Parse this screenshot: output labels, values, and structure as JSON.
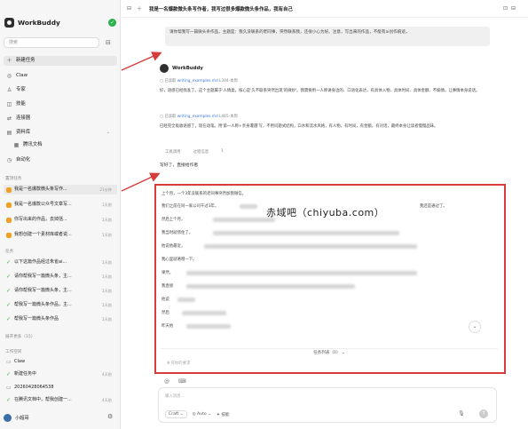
{
  "app": {
    "name": "WorkBuddy"
  },
  "sidebar": {
    "search_placeholder": "搜索",
    "nav": [
      {
        "label": "新建任务",
        "icon": "plus-icon"
      },
      {
        "label": "Claw",
        "icon": "claw-icon"
      },
      {
        "label": "专家",
        "icon": "expert-icon"
      },
      {
        "label": "技能",
        "icon": "skill-icon"
      },
      {
        "label": "连接器",
        "icon": "connector-icon"
      },
      {
        "label": "资料库",
        "icon": "library-icon"
      },
      {
        "label": "腾讯文档",
        "icon": "doc-icon"
      },
      {
        "label": "自动化",
        "icon": "auto-icon"
      }
    ],
    "pinned_label": "置顶任务",
    "pinned": [
      {
        "title": "我是一名爆款微头条写作...",
        "time": "21分钟"
      },
      {
        "title": "我是一名爆款公众号文章写...",
        "time": "1天前"
      },
      {
        "title": "你写出来的作品，去掉括...",
        "time": "1天前"
      },
      {
        "title": "我想创建一个素材库或者说...",
        "time": "1天前"
      }
    ],
    "tasks_label": "任务",
    "tasks": [
      {
        "title": "以下这篇作品经过朱雀ai...",
        "time": "1天前"
      },
      {
        "title": "请你帮我写一篇微头条，主...",
        "time": "1天前"
      },
      {
        "title": "请你帮我写一篇微头条，主...",
        "time": "1天前"
      },
      {
        "title": "帮我写一篇微头条作品，主...",
        "time": "1天前"
      },
      {
        "title": "帮我写一篇微头条作品",
        "time": "1天前"
      }
    ],
    "more_label": "展开更多（15）",
    "workspace_label": "工作空间",
    "workspace": [
      {
        "title": "Claw",
        "time": ""
      },
      {
        "title": "新建任务中",
        "time": "4天前"
      },
      {
        "title": "20260428064538",
        "time": ""
      },
      {
        "title": "在腾讯文档中，帮我创建一...",
        "time": "4天前"
      }
    ],
    "user": "小超哥"
  },
  "topbar": {
    "title": "我是一名爆款微头条写作者，我写过很多爆款微头条作品，我有自己"
  },
  "chat": {
    "prompt": "请你帮我写一篇微头条作品，主题是：我久没联系的老同事，突然联系我，还很小心为好。注意，写出来的作品，不能有ai创作痕迹。",
    "bot_name": "WorkBuddy",
    "ref1": "已读取",
    "ref1_file": "writing_examples.md",
    "ref1_meta": "L394-本周",
    "para1": "好，语感已经找准了。这个主题属于'人情类，核心是'久不联系突然出现'的微妙'。我需要用一人称讲身边的、口语化表达，有具体入物、具体时间、具体金额、不煽情，让事情本身说话。",
    "ref2": "已读取",
    "ref2_file": "writing_examples.md",
    "ref2_meta": "L465-本周",
    "para2": "已经完全吸收语感了，现在动笔。用'第一人称+亲身遭遇'写，不用问题式结构，口水和流水风格，有人物，有时间，有金额，有对话，最终本身让读者慢慢品味。",
    "tools": [
      "工具调用",
      "过程信息",
      "1"
    ],
    "done_label": "写好了，直接给作者",
    "body": [
      "上个月，一个3年没联系的老同事突然加我微信。",
      "我们之前在同一家公司干过3年，",
      "我还是通过了。",
      "然后上个月，",
      "我当时就愣住了，",
      "他说他最近，",
      "我心里就咯噔一下。",
      "果然，",
      "我直接",
      "他说",
      "然后",
      "昨天他"
    ],
    "watermark": "赤域吧（chiyuba.com）",
    "queue_label": "任务列表（0）",
    "input_placeholder": "补充你的要求",
    "composer_placeholder": "输入消息...",
    "mode": "Craft",
    "model": "Auto",
    "skill": "技能"
  }
}
